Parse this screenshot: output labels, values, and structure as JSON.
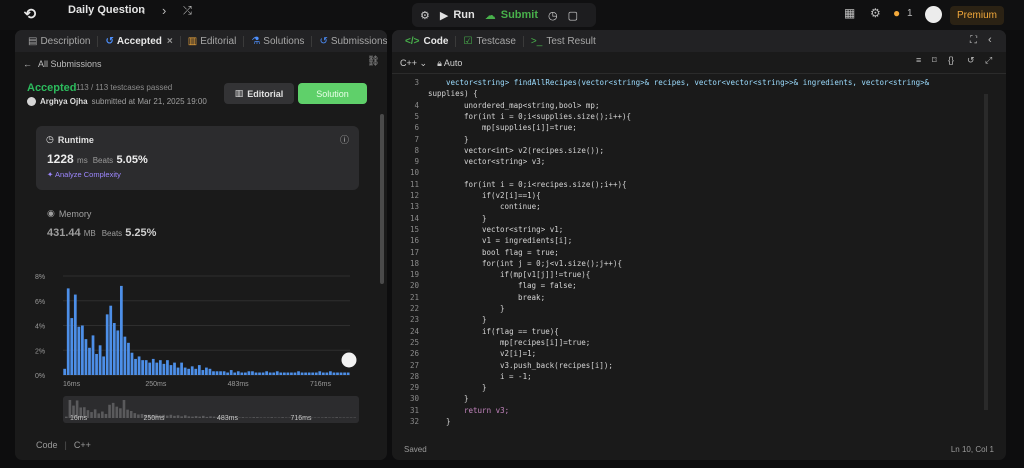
{
  "header": {
    "title": "Daily Question",
    "run_label": "Run",
    "submit_label": "Submit",
    "streak_count": "1",
    "premium_label": "Premium"
  },
  "left": {
    "tabs": [
      {
        "label": "Description"
      },
      {
        "label": "Accepted"
      },
      {
        "label": "Editorial"
      },
      {
        "label": "Solutions"
      },
      {
        "label": "Submissions"
      }
    ],
    "back_label": "All Submissions",
    "status": "Accepted",
    "testcases": "113 / 113 testcases passed",
    "author": "Arghya Ojha",
    "submitted": "submitted at Mar 21, 2025 19:00",
    "editorial_button": "Editorial",
    "solution_button": "Solution",
    "runtime": {
      "title": "Runtime",
      "value": "1228",
      "unit": "ms",
      "beats_label": "Beats",
      "beats": "5.05%",
      "analyze": "Analyze Complexity"
    },
    "memory": {
      "title": "Memory",
      "value": "431.44",
      "unit": "MB",
      "beats_label": "Beats",
      "beats": "5.25%"
    },
    "footer": {
      "code_label": "Code",
      "lang": "C++"
    }
  },
  "chart_data": {
    "type": "bar",
    "title": "",
    "ylabel": "",
    "y_ticks": [
      "8%",
      "6%",
      "4%",
      "2%",
      "0%"
    ],
    "ylim": [
      0,
      8
    ],
    "x_ticks": [
      "16ms",
      "250ms",
      "483ms",
      "716ms"
    ],
    "values": [
      0.5,
      7.0,
      4.6,
      6.5,
      3.9,
      4.0,
      2.9,
      2.2,
      3.2,
      1.7,
      2.4,
      1.5,
      4.9,
      5.6,
      4.2,
      3.6,
      7.2,
      3.1,
      2.6,
      1.8,
      1.3,
      1.5,
      1.2,
      1.2,
      1.0,
      1.3,
      1.0,
      1.2,
      0.9,
      1.2,
      0.8,
      1.0,
      0.6,
      1.0,
      0.6,
      0.5,
      0.7,
      0.5,
      0.8,
      0.4,
      0.6,
      0.5,
      0.3,
      0.3,
      0.3,
      0.3,
      0.2,
      0.4,
      0.2,
      0.3,
      0.2,
      0.2,
      0.3,
      0.3,
      0.2,
      0.2,
      0.2,
      0.3,
      0.2,
      0.2,
      0.3,
      0.2,
      0.2,
      0.2,
      0.2,
      0.2,
      0.3,
      0.2,
      0.2,
      0.2,
      0.2,
      0.2,
      0.3,
      0.2,
      0.2,
      0.3,
      0.2,
      0.2,
      0.2,
      0.2,
      0.2
    ],
    "mini_x_ticks": [
      "16ms",
      "250ms",
      "483ms",
      "716ms"
    ],
    "grid": true
  },
  "right": {
    "tabs": [
      {
        "label": "Code"
      },
      {
        "label": "Testcase"
      },
      {
        "label": "Test Result"
      }
    ],
    "language": "C++",
    "autocomplete": "Auto",
    "status_left": "Saved",
    "cursor": "Ln 10, Col 1",
    "lines": [
      {
        "no": "3",
        "text": "vector<string> findAllRecipes(vector<string>& recipes, vector<vector<string>>& ingredients, vector<string>&"
      },
      {
        "no": "",
        "text": "supplies) {"
      },
      {
        "no": "4",
        "text": "unordered_map<string,bool> mp;"
      },
      {
        "no": "5",
        "text": "for(int i = 0;i<supplies.size();i++){"
      },
      {
        "no": "6",
        "text": "mp[supplies[i]]=true;"
      },
      {
        "no": "7",
        "text": "}"
      },
      {
        "no": "8",
        "text": "vector<int> v2(recipes.size());"
      },
      {
        "no": "9",
        "text": "vector<string> v3;"
      },
      {
        "no": "10",
        "text": ""
      },
      {
        "no": "11",
        "text": "for(int i = 0;i<recipes.size();i++){"
      },
      {
        "no": "12",
        "text": "if(v2[i]==1){"
      },
      {
        "no": "13",
        "text": "continue;"
      },
      {
        "no": "14",
        "text": "}"
      },
      {
        "no": "15",
        "text": "vector<string> v1;"
      },
      {
        "no": "16",
        "text": "v1 = ingredients[i];"
      },
      {
        "no": "17",
        "text": "bool flag = true;"
      },
      {
        "no": "18",
        "text": "for(int j = 0;j<v1.size();j++){"
      },
      {
        "no": "19",
        "text": "if(mp[v1[j]]!=true){"
      },
      {
        "no": "20",
        "text": "flag = false;"
      },
      {
        "no": "21",
        "text": "break;"
      },
      {
        "no": "22",
        "text": "}"
      },
      {
        "no": "23",
        "text": "}"
      },
      {
        "no": "24",
        "text": "if(flag == true){"
      },
      {
        "no": "25",
        "text": "mp[recipes[i]]=true;"
      },
      {
        "no": "26",
        "text": "v2[i]=1;"
      },
      {
        "no": "27",
        "text": "v3.push_back(recipes[i]);"
      },
      {
        "no": "28",
        "text": "i = -1;"
      },
      {
        "no": "29",
        "text": "}"
      },
      {
        "no": "30",
        "text": "}"
      },
      {
        "no": "31",
        "text": "return v3;"
      },
      {
        "no": "32",
        "text": "}"
      }
    ]
  }
}
